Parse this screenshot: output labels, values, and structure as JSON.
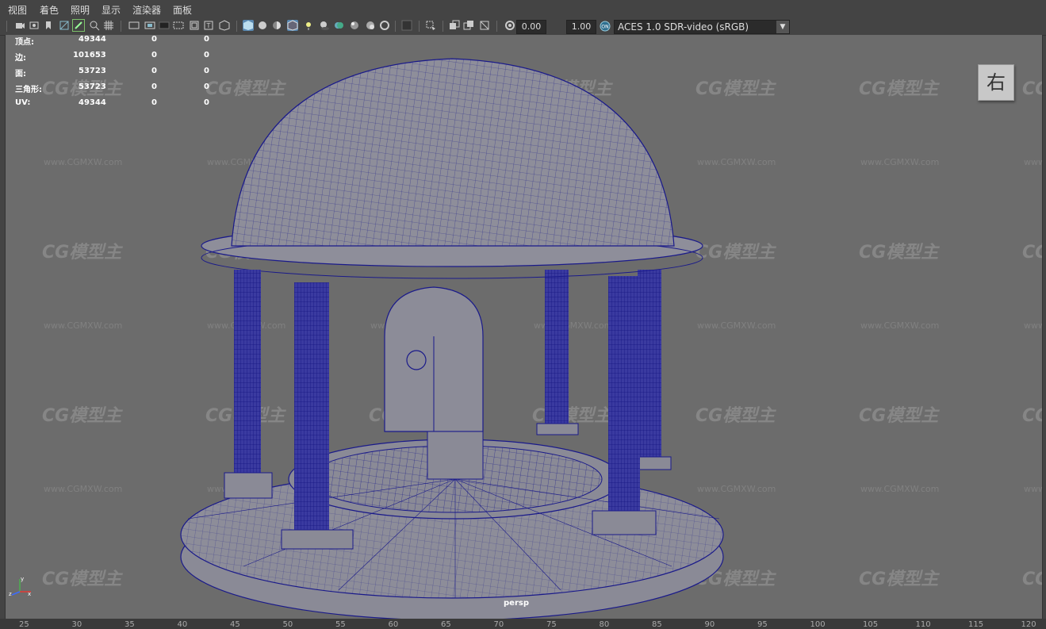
{
  "menubar": {
    "items": [
      "视图",
      "着色",
      "照明",
      "显示",
      "渲染器",
      "面板"
    ]
  },
  "toolbar": {
    "exposure_value": "0.00",
    "gamma_value": "1.00",
    "color_space": "ACES 1.0 SDR-video (sRGB)",
    "icons": [
      "camera-select-icon",
      "camera-attributes-icon",
      "bookmark-icon",
      "image-plane-icon",
      "grease-pencil-icon",
      "2d-pan-zoom-icon",
      "grid-icon",
      "film-gate-icon",
      "resolution-gate-icon",
      "gate-mask-icon",
      "field-chart-icon",
      "safe-action-icon",
      "safe-title-icon",
      "wireframe-icon",
      "smooth-shade-icon",
      "default-material-icon",
      "wireframe-on-shaded-icon",
      "xray-icon",
      "use-all-lights-icon",
      "shadows-icon",
      "screen-space-ao-icon",
      "motion-blur-icon",
      "multisample-aa-icon",
      "depth-of-field-icon",
      "isolate-select-icon",
      "xray-joints-icon",
      "xray-active-icon",
      "backface-icon",
      "exposure-icon",
      "gamma-icon",
      "color-management-icon"
    ]
  },
  "hud": {
    "rows": [
      {
        "label": "顶点:",
        "v1": "49344",
        "v2": "0",
        "v3": "0"
      },
      {
        "label": "边:",
        "v1": "101653",
        "v2": "0",
        "v3": "0"
      },
      {
        "label": "面:",
        "v1": "53723",
        "v2": "0",
        "v3": "0"
      },
      {
        "label": "三角形:",
        "v1": "53723",
        "v2": "0",
        "v3": "0"
      },
      {
        "label": "UV:",
        "v1": "49344",
        "v2": "0",
        "v3": "0"
      }
    ]
  },
  "viewcube": {
    "face": "右"
  },
  "camera_label": "persp",
  "axis": {
    "x": "x",
    "y": "y",
    "z": "z"
  },
  "watermark": {
    "logo": "CG模型主",
    "url": "www.CGMXW.com"
  },
  "ruler": {
    "ticks": [
      "25",
      "30",
      "35",
      "40",
      "45",
      "50",
      "55",
      "60",
      "65",
      "70",
      "75",
      "80",
      "85",
      "90",
      "95",
      "100",
      "105",
      "110",
      "115",
      "120"
    ]
  },
  "colors": {
    "viewport_bg": "#6c6c6c",
    "wire": "#1a1a8a",
    "mesh_fill": "#8a8a96",
    "menu_bg": "#444444"
  }
}
